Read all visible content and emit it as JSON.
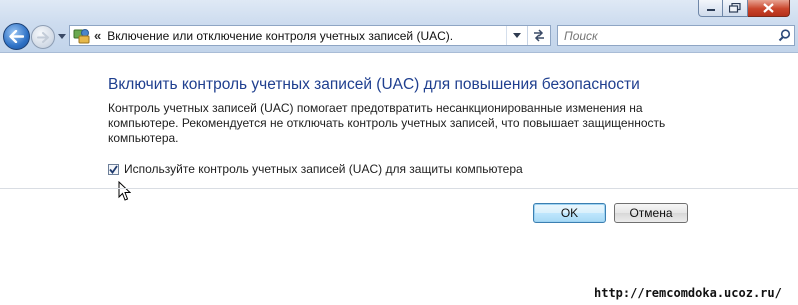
{
  "window": {
    "caption_buttons": [
      "minimize",
      "maximize",
      "close"
    ]
  },
  "navigation": {
    "address_chevron": "«",
    "address_text": "Включение или отключение контроля учетных записей (UAC).",
    "search_placeholder": "Поиск"
  },
  "content": {
    "heading": "Включить контроль учетных записей (UAC) для повышения безопасности",
    "description": "Контроль учетных записей (UAC) помогает предотвратить несанкционированные изменения на компьютере.  Рекомендуется не отключать контроль учетных записей, что повышает защищенность компьютера.",
    "checkbox_label": "Используйте контроль учетных записей (UAC) для защиты компьютера",
    "checkbox_checked": true
  },
  "buttons": {
    "ok_label": "OK",
    "cancel_label": "Отмена"
  },
  "watermark": "http://remcomdoka.ucoz.ru/",
  "colors": {
    "heading": "#1f3f8f",
    "chrome": "#cddcef",
    "ok_accent": "#3c7fb1"
  },
  "icons": [
    "minimize-icon",
    "maximize-icon",
    "close-icon",
    "back-arrow-icon",
    "forward-arrow-icon",
    "dropdown-arrow-icon",
    "control-panel-icon",
    "refresh-icon",
    "search-icon",
    "checkmark-icon",
    "mouse-cursor-icon"
  ]
}
